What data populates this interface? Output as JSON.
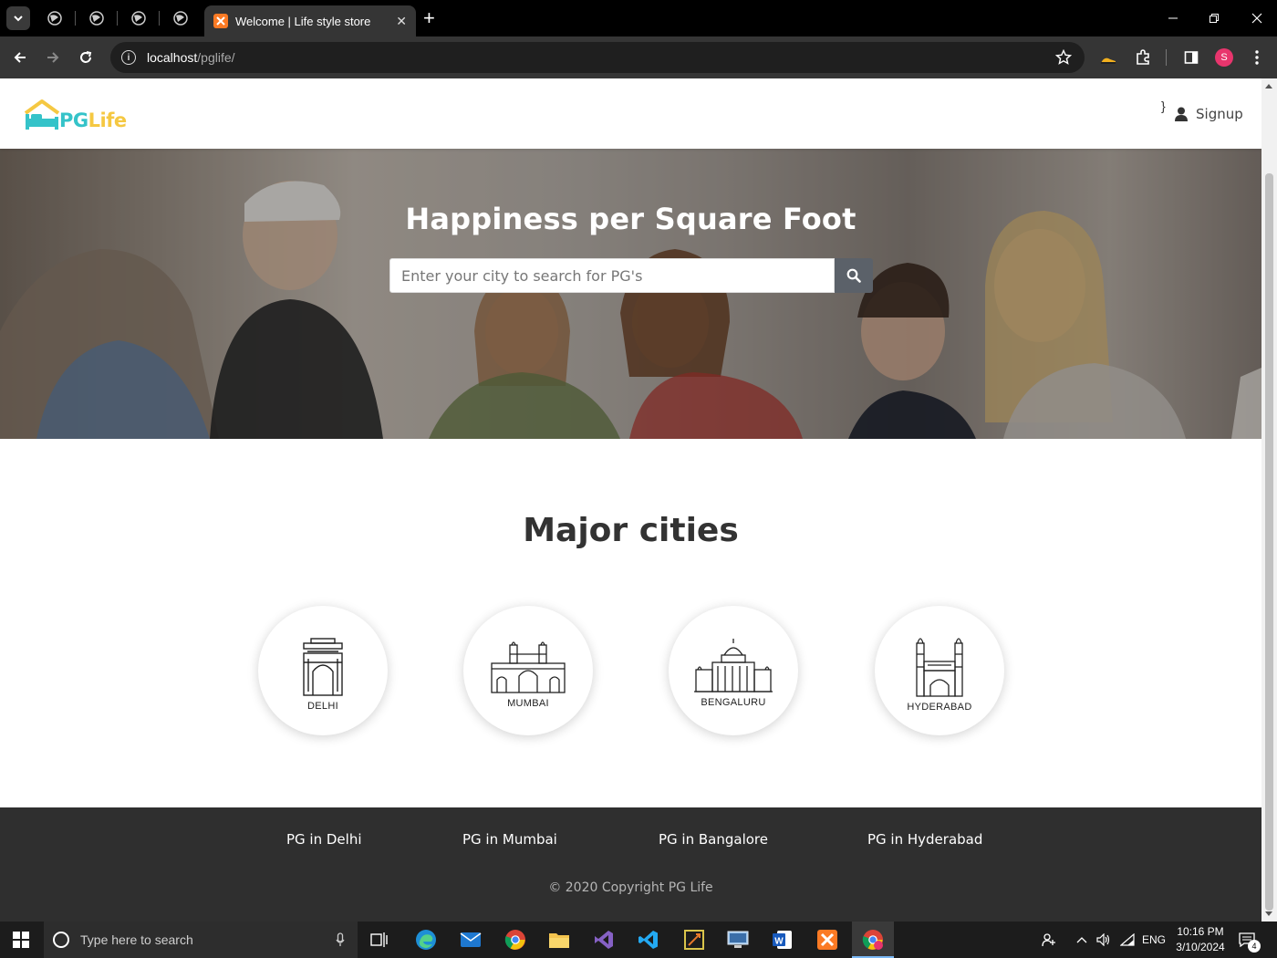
{
  "browser": {
    "active_tab_title": "Welcome | Life style store",
    "url_host": "localhost",
    "url_path": "/pglife/",
    "profile_initial": "S"
  },
  "header": {
    "logo_pg": "PG",
    "logo_life": "Life",
    "stray_char": "}",
    "signup_label": "Signup"
  },
  "hero": {
    "title": "Happiness per Square Foot",
    "search_placeholder": "Enter your city to search for PG's"
  },
  "cities": {
    "title": "Major cities",
    "items": [
      {
        "name": "DELHI"
      },
      {
        "name": "MUMBAI"
      },
      {
        "name": "BENGALURU"
      },
      {
        "name": "HYDERABAD"
      }
    ]
  },
  "footer": {
    "links": [
      "PG in Delhi",
      "PG in Mumbai",
      "PG in Bangalore",
      "PG in Hyderabad"
    ],
    "copyright": "© 2020 Copyright PG Life"
  },
  "taskbar": {
    "search_placeholder": "Type here to search",
    "language": "ENG",
    "time": "10:16 PM",
    "date": "3/10/2024",
    "notification_count": "4"
  },
  "colors": {
    "logo_teal": "#35c3c9",
    "logo_yellow": "#f5c842",
    "footer_bg": "#2f2f2f",
    "search_button": "#5b6169"
  }
}
